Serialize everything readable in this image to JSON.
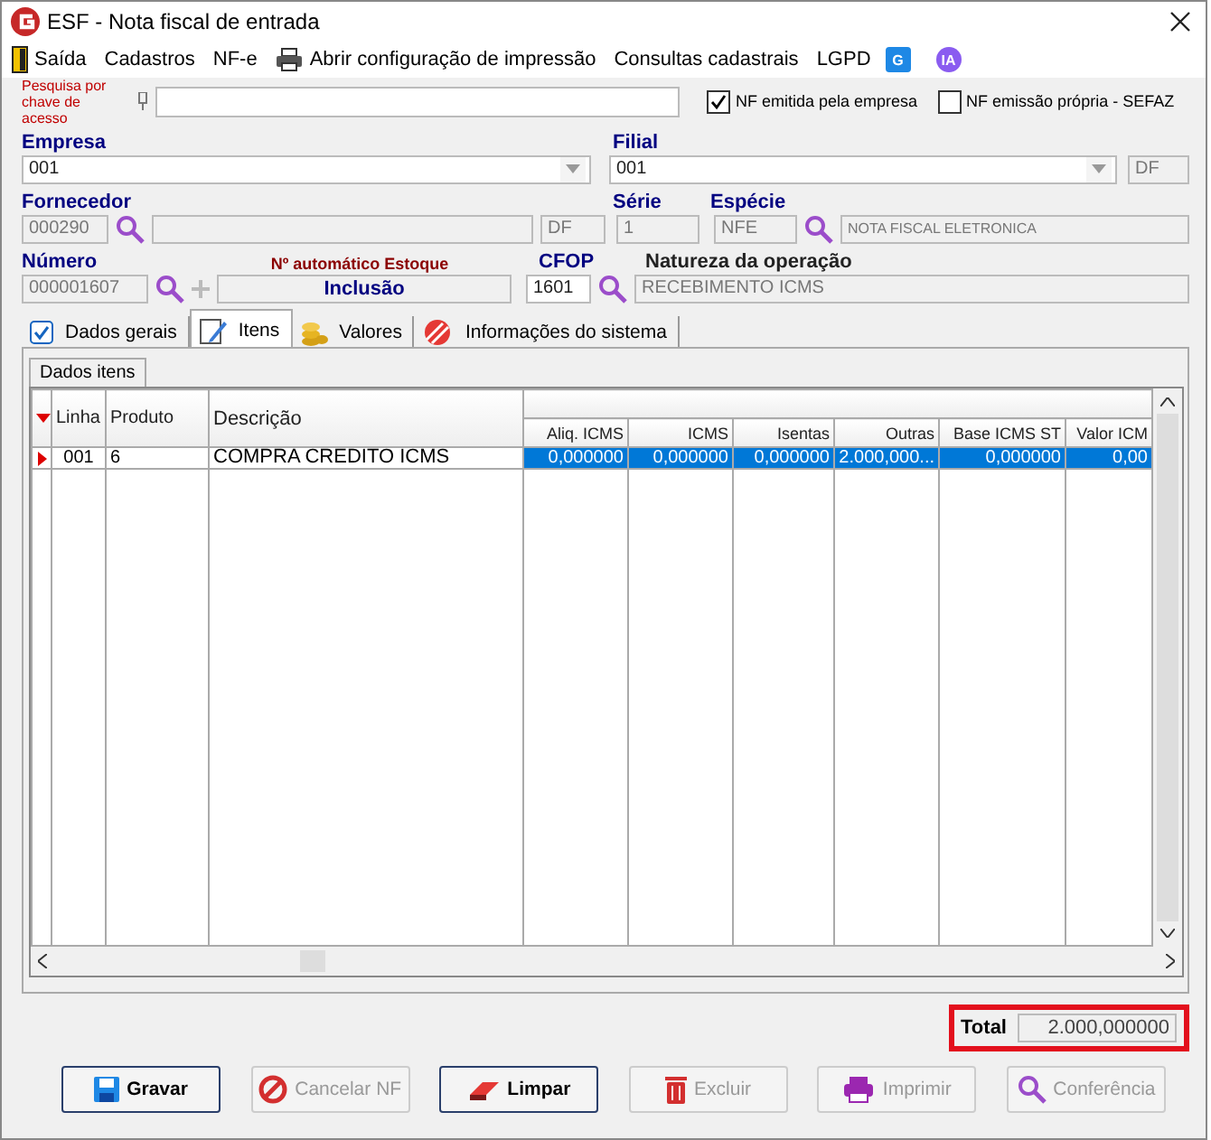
{
  "window": {
    "title": "ESF - Nota fiscal de entrada"
  },
  "menu": [
    {
      "label": "Saída",
      "kind": "door"
    },
    {
      "label": "Cadastros",
      "kind": "none"
    },
    {
      "label": "NF-e",
      "kind": "none"
    },
    {
      "label": "Abrir configuração de impressão",
      "kind": "printer"
    },
    {
      "label": "Consultas cadastrais",
      "kind": "none"
    },
    {
      "label": "LGPD",
      "kind": "none"
    },
    {
      "label": "G",
      "kind": "badge-g"
    },
    {
      "label": "IA",
      "kind": "badge-ia"
    }
  ],
  "search": {
    "label": "Pesquisa por chave de acesso"
  },
  "checkboxes": [
    {
      "label": "NF emitida pela empresa",
      "checked": true
    },
    {
      "label": "NF emissão própria - SEFAZ",
      "checked": false
    }
  ],
  "empresa": {
    "label": "Empresa",
    "value": "001"
  },
  "filial": {
    "label": "Filial",
    "value": "001",
    "uf": "DF"
  },
  "fornecedor": {
    "label": "Fornecedor",
    "code": "000290",
    "uf": "DF"
  },
  "serie": {
    "label": "Série",
    "value": "1"
  },
  "especie": {
    "label": "Espécie",
    "code": "NFE",
    "description": "NOTA FISCAL ELETRONICA"
  },
  "numero": {
    "label": "Número",
    "value": "000001607"
  },
  "estoque": {
    "label": "Nº automático Estoque",
    "value": "Inclusão"
  },
  "cfop": {
    "label": "CFOP",
    "value": "1601"
  },
  "natureza": {
    "label": "Natureza da operação",
    "value": "RECEBIMENTO ICMS"
  },
  "tabs": [
    {
      "label": "Dados gerais",
      "kind": "check",
      "selected": false
    },
    {
      "label": "Itens",
      "kind": "pencil",
      "selected": true
    },
    {
      "label": "Valores",
      "kind": "coins",
      "selected": false
    },
    {
      "label": "Informações do sistema",
      "kind": "stripes",
      "selected": false
    }
  ],
  "inner_tab": "Dados itens",
  "table": {
    "columns": [
      "Linha",
      "Produto",
      "Descrição",
      "Aliq. ICMS",
      "ICMS",
      "Isentas",
      "Outras",
      "Base ICMS ST",
      "Valor ICM"
    ],
    "rows": [
      {
        "selected": true,
        "cells": [
          "001",
          "6",
          "COMPRA CREDITO ICMS",
          "0,000000",
          "0,000000",
          "0,000000",
          "2.000,000...",
          "0,000000",
          "0,00"
        ]
      }
    ]
  },
  "total": {
    "label": "Total",
    "value": "2.000,000000"
  },
  "buttons": [
    {
      "label": "Gravar",
      "kind": "save",
      "disabled": false
    },
    {
      "label": "Cancelar NF",
      "kind": "cancel",
      "disabled": true
    },
    {
      "label": "Limpar",
      "kind": "eraser",
      "disabled": false
    },
    {
      "label": "Excluir",
      "kind": "trash",
      "disabled": true
    },
    {
      "label": "Imprimir",
      "kind": "printer",
      "disabled": true
    },
    {
      "label": "Conferência",
      "kind": "search",
      "disabled": true
    }
  ]
}
